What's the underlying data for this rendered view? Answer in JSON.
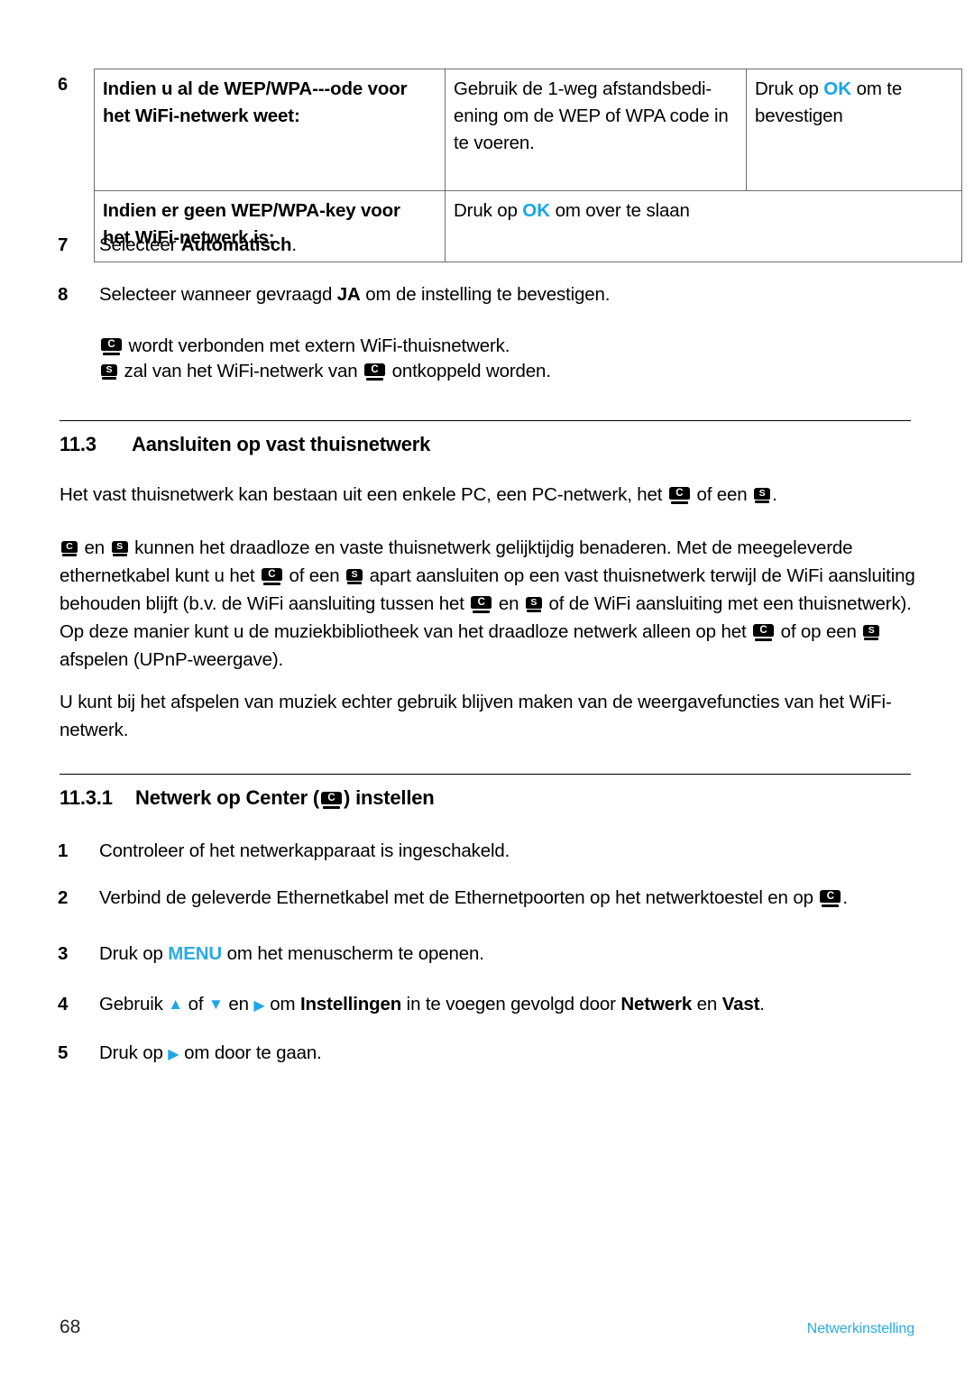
{
  "document": {
    "language": "nl",
    "accent_color": "#29abe2",
    "footer": {
      "page_number": "68",
      "section_label": "Netwerkinstelling"
    }
  },
  "step6": {
    "number": "6",
    "table": {
      "rows": [
        {
          "condition": "Indien u al de WEP/WPA---ode voor het WiFi-netwerk weet:",
          "condition_line1": "Indien u al de WEP/WPA---ode voor",
          "condition_line2": "het WiFi-netwerk weet:",
          "action_pre": "Gebruik de 1-weg afstandsbedi- ening om de WEP of WPA code in te voeren.",
          "confirm_pre": "Druk op ",
          "confirm_key": "OK",
          "confirm_post": " om te bevestigen"
        },
        {
          "condition_line1": "Indien er geen WEP/WPA-key voor",
          "condition_line2": "het WiFi-netwerk is:",
          "action_pre": "Druk op ",
          "action_key": "OK",
          "action_post": " om over te slaan"
        }
      ]
    }
  },
  "steps": {
    "s7": {
      "number": "7",
      "pre": "Selecteer ",
      "bold": "Automatisch",
      "post": "."
    },
    "s8": {
      "number": "8",
      "pre": "Selecteer wanneer gevraagd ",
      "bold": "JA",
      "post": " om de instelling te bevestigen."
    },
    "s8_note1": {
      "icon": "C",
      "text": " wordt verbonden met extern WiFi-thuisnetwerk."
    },
    "s8_note2": {
      "icon1": "S",
      "mid": " zal van het WiFi-netwerk van ",
      "icon2": "C",
      "end": " ontkoppeld worden."
    }
  },
  "section_11_3": {
    "number": "11.3",
    "title": "Aansluiten op vast thuisnetwerk",
    "para1": {
      "part1": "Het vast thuisnetwerk kan bestaan uit een enkele PC, een PC-netwerk, het ",
      "icon1": "C",
      "part2": " of een ",
      "icon2": "S",
      "part3": "."
    },
    "para2": {
      "p1": "",
      "icon1": "C",
      "p2": " en ",
      "icon2": "S",
      "p3": " kunnen het draadloze en vaste thuisnetwerk gelijktijdig benaderen. Met de meegeleverde ethernetkabel kunt u het ",
      "icon3": "C",
      "p4": " of een ",
      "icon4": "S",
      "p5": " apart aansluiten op een vast thuisnetwerk terwijl de WiFi aansluiting behouden blijft (b.v. de WiFi aansluiting tussen het ",
      "icon5": "C",
      "p6": " en ",
      "icon6": "S",
      "p7": " of de WiFi aansluiting met een thuisnetwerk). Op deze manier kunt u de muziekbibliotheek van het draadloze netwerk alleen op het ",
      "icon7": "C",
      "p8": " of op een ",
      "icon8": "S",
      "p9": " afspelen (UPnP-weergave)."
    },
    "para3": "U kunt bij het afspelen van muziek echter gebruik blijven maken van de weergavefuncties van het WiFi-netwerk."
  },
  "section_11_3_1": {
    "number": "11.3.1",
    "title_pre": "Netwerk op Center (",
    "title_icon": "C",
    "title_post": ") instellen",
    "steps": [
      {
        "number": "1",
        "text": "Controleer of het netwerkapparaat is ingeschakeld."
      },
      {
        "number": "2",
        "pre": "Verbind de geleverde Ethernetkabel met de Ethernetpoorten op het netwerktoestel en op ",
        "icon": "C",
        "post": "."
      },
      {
        "number": "3",
        "pre": "Druk op ",
        "key": "MENU",
        "post": " om het menuscherm te openen."
      },
      {
        "number": "4",
        "p1": "Gebruik ",
        "arrow_up": "▲",
        "p2": " of ",
        "arrow_down": "▼",
        "p3": " en ",
        "arrow_right": "▶",
        "p4": " om ",
        "bold1": "Instellingen",
        "p5": " in te voegen gevolgd door ",
        "bold2": "Netwerk",
        "p6": " en ",
        "bold3": "Vast",
        "p7": "."
      },
      {
        "number": "5",
        "pre": "Druk op ",
        "arrow_right": "▶",
        "post": " om door te gaan."
      }
    ]
  }
}
